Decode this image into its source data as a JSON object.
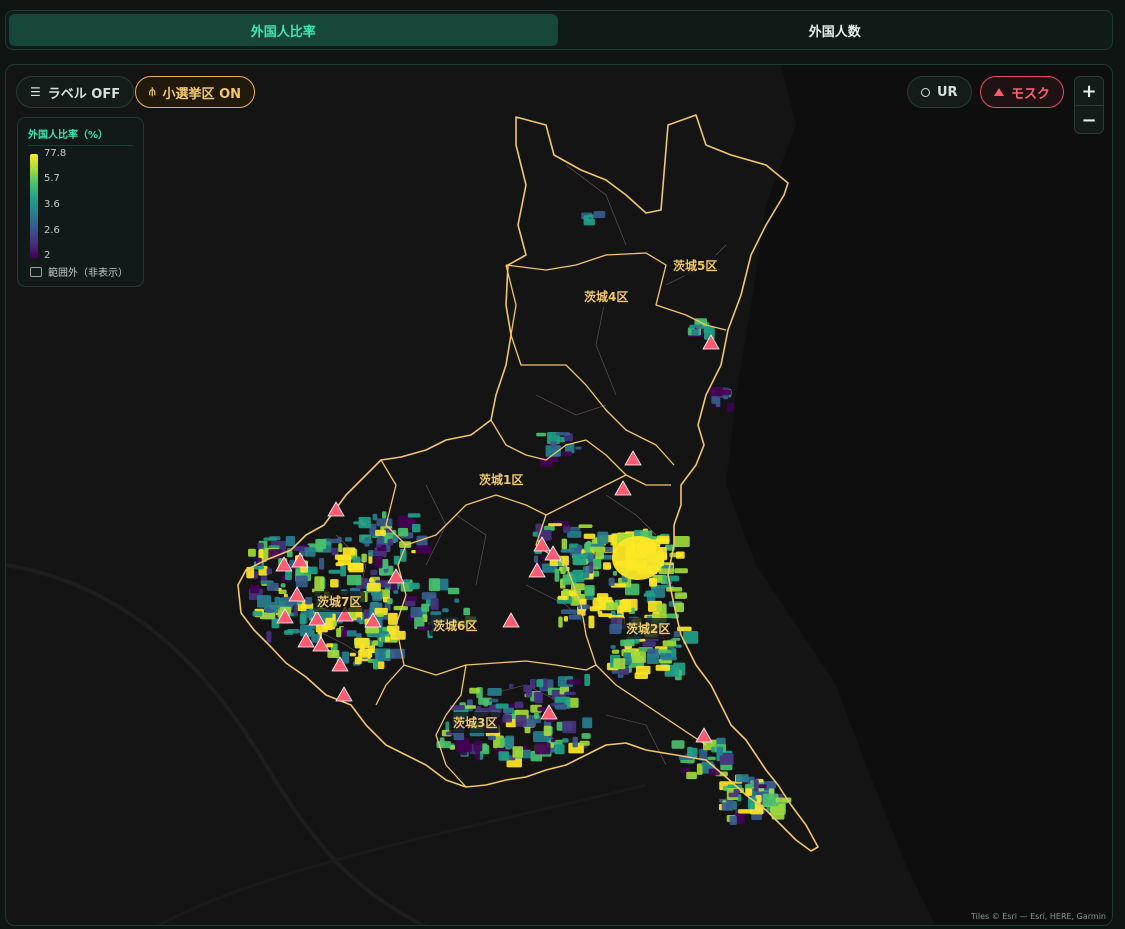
{
  "tabs": [
    {
      "label": "外国人比率",
      "active": true
    },
    {
      "label": "外国人数",
      "active": false
    }
  ],
  "controls": {
    "label_toggle": "ラベル OFF",
    "district_toggle": "小選挙区 ON",
    "ur_toggle": "UR",
    "mosque_toggle": "モスク",
    "zoom_in": "+",
    "zoom_out": "−"
  },
  "legend": {
    "title": "外国人比率（%）",
    "ticks": [
      "77.8",
      "5.7",
      "3.6",
      "2.6",
      "2"
    ],
    "out_of_range": "範囲外（非表示）"
  },
  "districts": {
    "d1": "茨城1区",
    "d2": "茨城2区",
    "d3": "茨城3区",
    "d4": "茨城4区",
    "d5": "茨城5区",
    "d6": "茨城6区",
    "d7": "茨城7区"
  },
  "attribution": "Tiles © Esri — Esri, HERE, Garmin",
  "colors": {
    "accent": "#3ee6b2",
    "district_border": "#f1c76a",
    "mosque": "#ff5a72",
    "viridis": [
      "#440154",
      "#46327e",
      "#365c8d",
      "#277f8e",
      "#1fa187",
      "#4ac16d",
      "#a0da39",
      "#fde725"
    ]
  },
  "icons": [
    "filter-icon",
    "district-icon",
    "ur-icon",
    "mosque-icon"
  ]
}
